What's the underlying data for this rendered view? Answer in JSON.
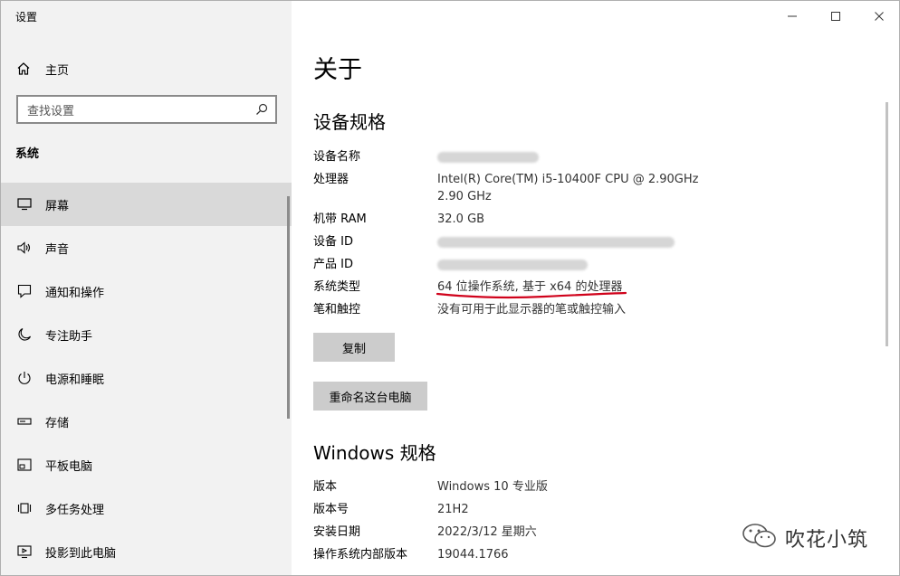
{
  "window": {
    "title": "设置"
  },
  "sidebar": {
    "home_label": "主页",
    "search_placeholder": "查找设置",
    "section_title": "系统",
    "items": [
      {
        "label": "屏幕",
        "icon": "monitor-icon",
        "active": true
      },
      {
        "label": "声音",
        "icon": "speaker-icon"
      },
      {
        "label": "通知和操作",
        "icon": "notification-icon"
      },
      {
        "label": "专注助手",
        "icon": "moon-icon"
      },
      {
        "label": "电源和睡眠",
        "icon": "power-icon"
      },
      {
        "label": "存储",
        "icon": "storage-icon"
      },
      {
        "label": "平板电脑",
        "icon": "tablet-icon"
      },
      {
        "label": "多任务处理",
        "icon": "multitask-icon"
      },
      {
        "label": "投影到此电脑",
        "icon": "projection-icon"
      }
    ]
  },
  "main": {
    "page_title": "关于",
    "device_specs": {
      "heading": "设备规格",
      "rows": [
        {
          "key": "设备名称",
          "value": "",
          "blurred": true
        },
        {
          "key": "处理器",
          "value": "Intel(R) Core(TM) i5-10400F CPU @ 2.90GHz   2.90 GHz"
        },
        {
          "key": "机带 RAM",
          "value": "32.0 GB"
        },
        {
          "key": "设备 ID",
          "value": "",
          "blurred": true
        },
        {
          "key": "产品 ID",
          "value": "",
          "blurred": true
        },
        {
          "key": "系统类型",
          "value": "64 位操作系统, 基于 x64 的处理器"
        },
        {
          "key": "笔和触控",
          "value": "没有可用于此显示器的笔或触控输入"
        }
      ],
      "copy_button": "复制",
      "rename_button": "重命名这台电脑"
    },
    "windows_specs": {
      "heading": "Windows 规格",
      "rows": [
        {
          "key": "版本",
          "value": "Windows 10 专业版"
        },
        {
          "key": "版本号",
          "value": "21H2"
        },
        {
          "key": "安装日期",
          "value": "2022/3/12 星期六"
        },
        {
          "key": "操作系统内部版本",
          "value": "19044.1766"
        }
      ]
    }
  },
  "watermark": {
    "text": "吹花小筑"
  },
  "colors": {
    "sidebar_bg": "#f2f2f2",
    "active_item": "#d9d9d9",
    "button_bg": "#cccccc",
    "annotation_red": "#d0021b"
  }
}
